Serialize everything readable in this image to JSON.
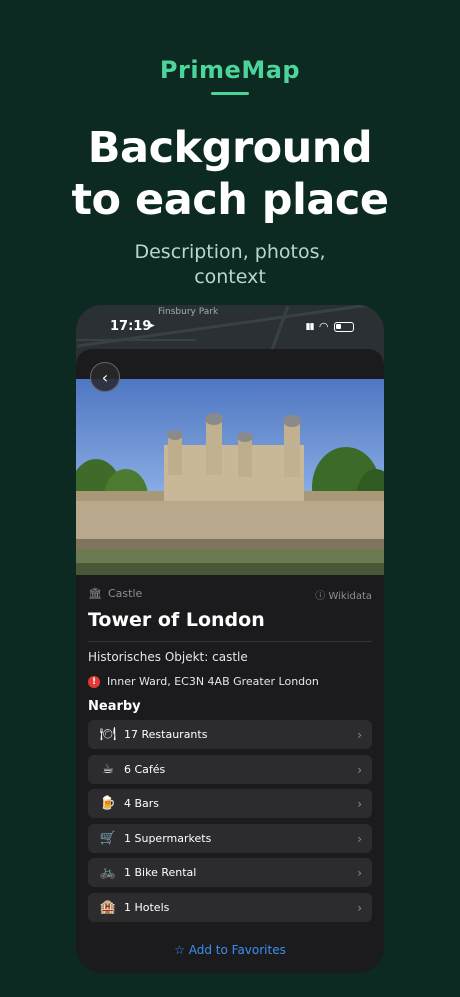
{
  "brand": "PrimeMap",
  "headline": [
    "Background",
    "to each place"
  ],
  "subhead": [
    "Description, photos,",
    "context"
  ],
  "status": {
    "time": "17:19",
    "map_label": "Finsbury Park"
  },
  "place": {
    "category": "Castle",
    "source": "Wikidata",
    "title": "Tower of London",
    "description": "Historisches Objekt: castle",
    "address": "Inner Ward, EC3N 4AB Greater London"
  },
  "nearby": {
    "heading": "Nearby",
    "items": [
      {
        "label": "17 Restaurants",
        "icon": "restaurant-icon",
        "glyph": "🍽"
      },
      {
        "label": "6 Cafés",
        "icon": "coffee-icon",
        "glyph": "☕"
      },
      {
        "label": "4 Bars",
        "icon": "beer-icon",
        "glyph": "🍺"
      },
      {
        "label": "1 Supermarkets",
        "icon": "cart-icon",
        "glyph": "🛒"
      },
      {
        "label": "1 Bike Rental",
        "icon": "bike-icon",
        "glyph": "🚲"
      },
      {
        "label": "1 Hotels",
        "icon": "hotel-icon",
        "glyph": "🏨"
      }
    ]
  },
  "favorites_label": "Add to Favorites",
  "colors": {
    "accent": "#4cd49a",
    "link": "#3d8ef0",
    "background": "#0d2a22"
  }
}
